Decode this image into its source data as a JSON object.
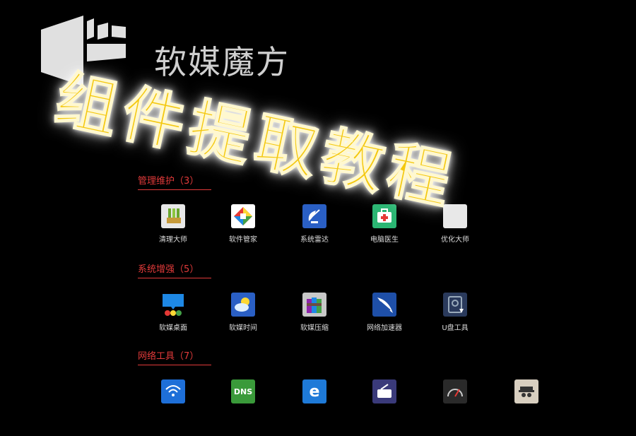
{
  "brand": {
    "name": "软媒魔方"
  },
  "overlay": {
    "title": "组件提取教程"
  },
  "sections": [
    {
      "label": "管理维护",
      "count": "3",
      "apps": [
        {
          "label": "清理大师",
          "icon": "broom-icon",
          "color": "#e8e8e8"
        },
        {
          "label": "软件管家",
          "icon": "app-manager-icon",
          "color": "#ffffff"
        },
        {
          "label": "系统雷达",
          "icon": "radar-dish-icon",
          "color": "#2a5fc4"
        },
        {
          "label": "电脑医生",
          "icon": "first-aid-icon",
          "color": "#2bb673"
        },
        {
          "label": "优化大师",
          "icon": "optimizer-icon",
          "color": "#e8e8e8"
        }
      ]
    },
    {
      "label": "系统增强",
      "count": "5",
      "apps": [
        {
          "label": "软媒桌面",
          "icon": "desktop-bubble-icon",
          "color": "#1e88e5"
        },
        {
          "label": "软媒时间",
          "icon": "weather-time-icon",
          "color": "#2a5fc4"
        },
        {
          "label": "软媒压缩",
          "icon": "archive-books-icon",
          "color": "#c8c8c8"
        },
        {
          "label": "网络加速器",
          "icon": "rocket-icon",
          "color": "#1e4fa8"
        },
        {
          "label": "U盘工具",
          "icon": "usb-disk-icon",
          "color": "#2a3a5c"
        }
      ]
    },
    {
      "label": "网络工具",
      "count": "7",
      "apps": [
        {
          "label": "",
          "icon": "wifi-share-icon",
          "color": "#1e6fd8"
        },
        {
          "label": "",
          "icon": "dns-icon",
          "color": "#3a9a3a"
        },
        {
          "label": "",
          "icon": "ie-browser-icon",
          "color": "#1e7ad8"
        },
        {
          "label": "",
          "icon": "radio-icon",
          "color": "#3a3a7a"
        },
        {
          "label": "",
          "icon": "speedometer-icon",
          "color": "#2a2a2a"
        },
        {
          "label": "",
          "icon": "spy-icon",
          "color": "#d8cfc0"
        }
      ]
    }
  ]
}
